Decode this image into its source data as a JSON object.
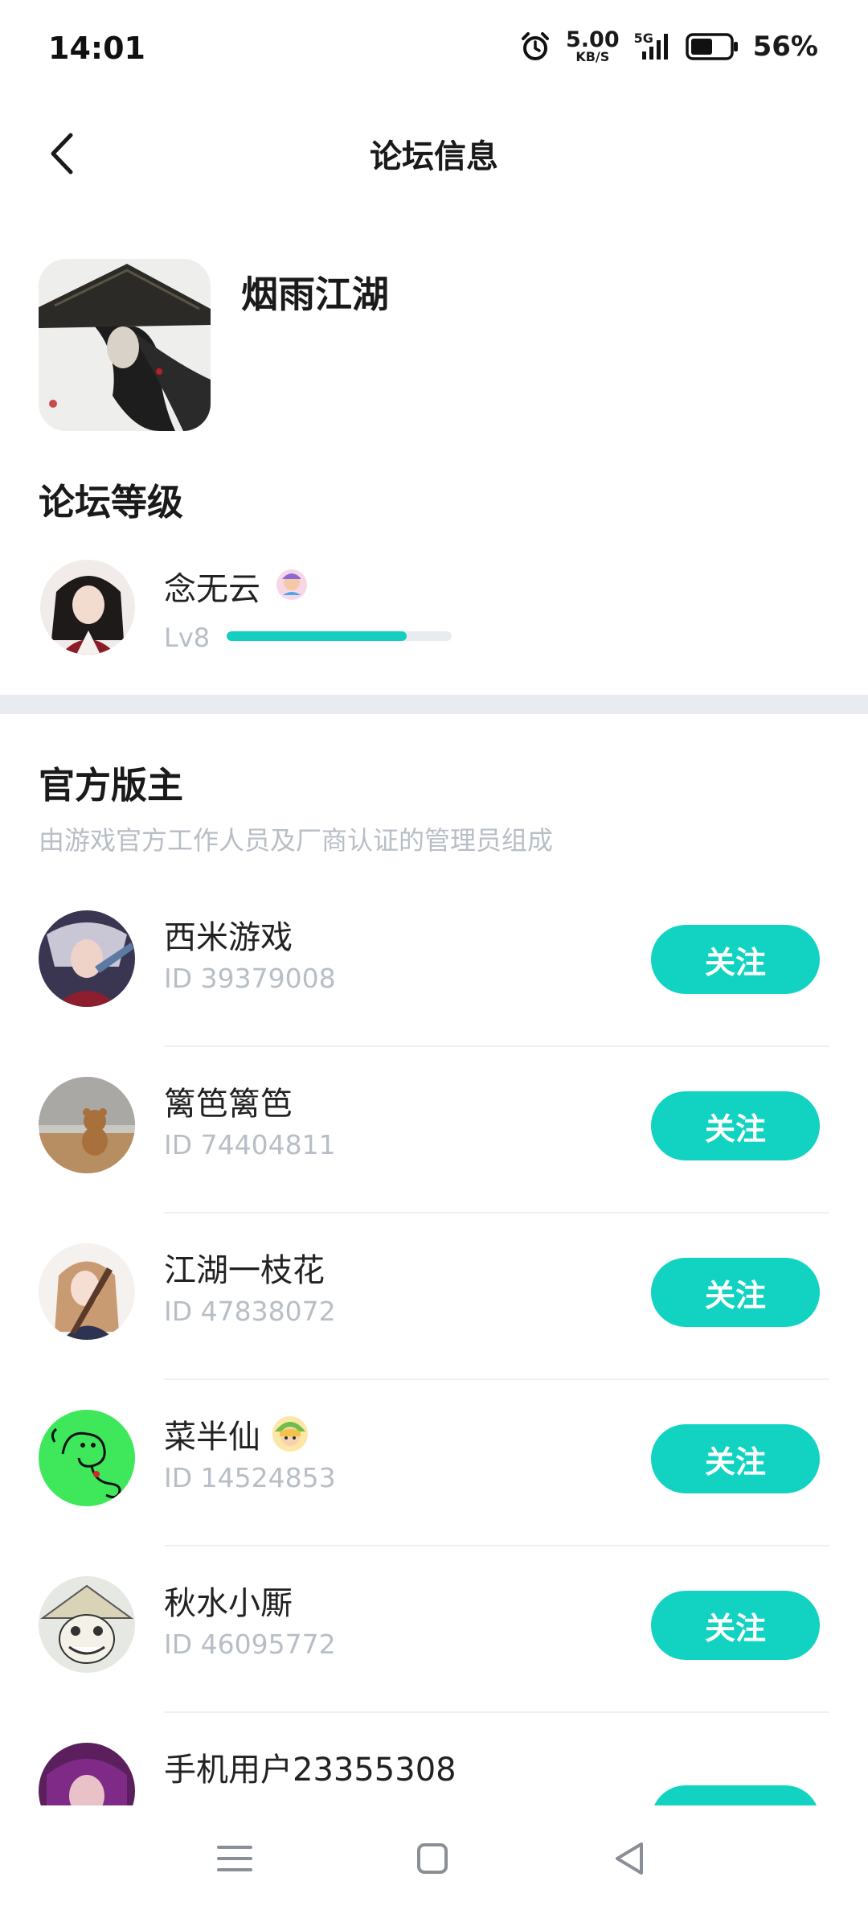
{
  "status_bar": {
    "time": "14:01",
    "net_speed_value": "5.00",
    "net_speed_unit": "KB/S",
    "network": "5G",
    "battery_percent": "56%",
    "battery_level": 0.56
  },
  "nav": {
    "title": "论坛信息"
  },
  "forum": {
    "name": "烟雨江湖"
  },
  "level_section": {
    "title": "论坛等级",
    "user_name": "念无云",
    "level": "Lv8",
    "progress": 0.8
  },
  "moderators": {
    "title": "官方版主",
    "subtitle": "由游戏官方工作人员及厂商认证的管理员组成",
    "follow_label": "关注",
    "items": [
      {
        "name": "西米游戏",
        "id": "ID 39379008"
      },
      {
        "name": "篱笆篱笆",
        "id": "ID 74404811"
      },
      {
        "name": "江湖一枝花",
        "id": "ID 47838072"
      },
      {
        "name": "菜半仙",
        "id": "ID 14524853"
      },
      {
        "name": "秋水小厮",
        "id": "ID 46095772"
      },
      {
        "name": "手机用户23355308",
        "id": ""
      }
    ]
  },
  "colors": {
    "accent": "#12d3c2",
    "muted_text": "#b8bec6",
    "divider": "#e8ebf0"
  }
}
